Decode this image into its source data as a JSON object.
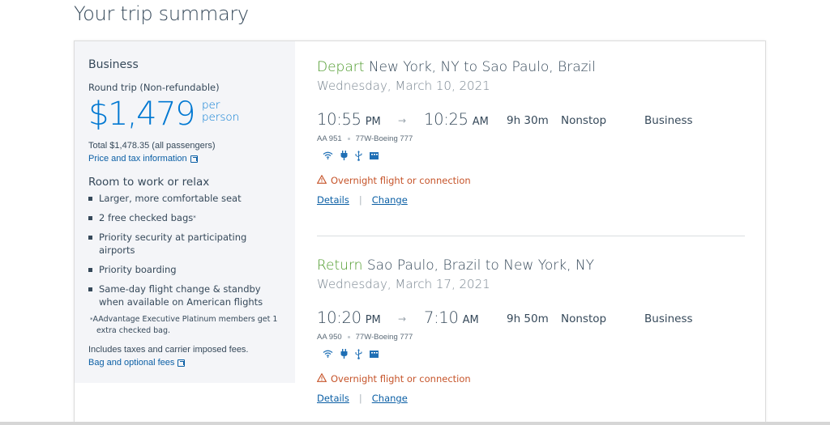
{
  "page": {
    "title": "Your trip summary"
  },
  "summary": {
    "cabin": "Business",
    "trip_type": "Round trip (Non-refundable)",
    "price": "$1,479",
    "price_unit_line1": "per",
    "price_unit_line2": "person",
    "total": "Total $1,478.35 (all passengers)",
    "price_link": "Price and tax information",
    "perks_title": "Room to work or relax",
    "perks": [
      {
        "text": "Larger, more comfortable seat",
        "sup": ""
      },
      {
        "text": "2 free checked bags",
        "sup": "*"
      },
      {
        "text": "Priority security at participating airports",
        "sup": ""
      },
      {
        "text": "Priority boarding",
        "sup": ""
      },
      {
        "text": "Same-day flight change & standby when available on American flights",
        "sup": ""
      }
    ],
    "footnote_mark": "*",
    "footnote_line1": "AAdvantage Executive Platinum members get 1",
    "footnote_line2": "extra checked bag.",
    "includes": "Includes taxes and carrier imposed fees.",
    "bag_link": "Bag and optional fees"
  },
  "flights": [
    {
      "direction": "Depart",
      "route": "New York, NY to Sao Paulo, Brazil",
      "date": "Wednesday, March 10, 2021",
      "depart_time": "10:55",
      "depart_ampm": "PM",
      "arrow": "→",
      "arrive_time": "10:25",
      "arrive_ampm": "AM",
      "duration": "9h 30m",
      "stops": "Nonstop",
      "cabin": "Business",
      "flight_number": "AA 951",
      "aircraft": "77W-Boeing 777",
      "amenities": [
        "wifi-icon",
        "power-icon",
        "usb-icon",
        "entertainment-icon"
      ],
      "warning": "Overnight flight or connection",
      "details_link": "Details",
      "separator": "|",
      "change_link": "Change"
    },
    {
      "direction": "Return",
      "route": "Sao Paulo, Brazil to New York, NY",
      "date": "Wednesday, March 17, 2021",
      "depart_time": "10:20",
      "depart_ampm": "PM",
      "arrow": "→",
      "arrive_time": "7:10",
      "arrive_ampm": "AM",
      "duration": "9h 50m",
      "stops": "Nonstop",
      "cabin": "Business",
      "flight_number": "AA 950",
      "aircraft": "77W-Boeing 777",
      "amenities": [
        "wifi-icon",
        "power-icon",
        "usb-icon",
        "entertainment-icon"
      ],
      "warning": "Overnight flight or connection",
      "details_link": "Details",
      "separator": "|",
      "change_link": "Change"
    }
  ],
  "colors": {
    "brand_blue": "#0078d2",
    "link_blue": "#0b5fa5",
    "direction_green": "#4c9a2a",
    "warning_orange": "#c6542a",
    "panel_bg": "#f4f5f8",
    "text_dark": "#36495a"
  }
}
